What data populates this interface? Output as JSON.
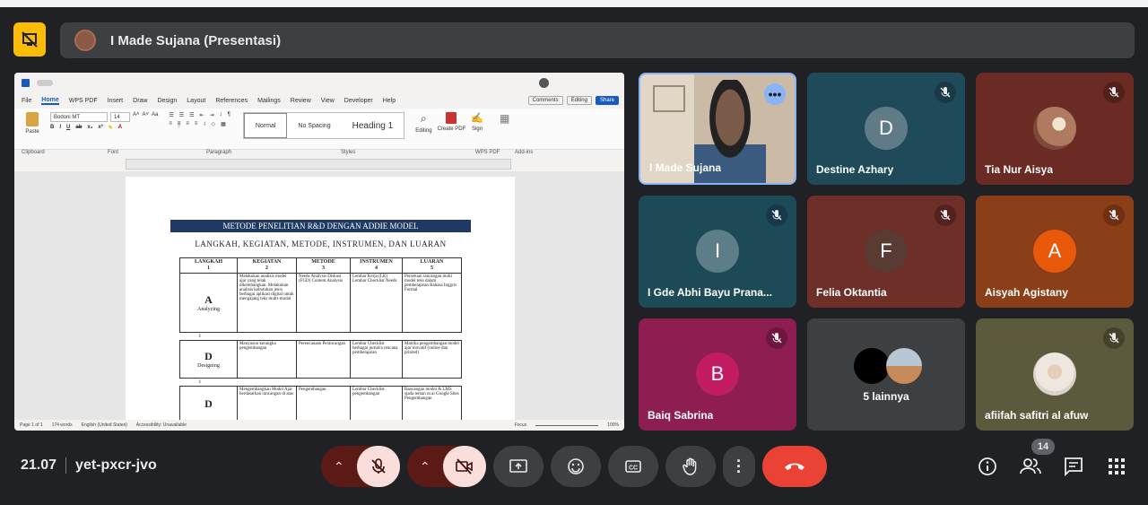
{
  "presenter": {
    "name": "I Made Sujana (Presentasi)"
  },
  "word": {
    "tabs": [
      "File",
      "Home",
      "WPS PDF",
      "Insert",
      "Draw",
      "Design",
      "Layout",
      "References",
      "Mailings",
      "Review",
      "View",
      "Developer",
      "Help"
    ],
    "active_tab": "Home",
    "comments_label": "Comments",
    "editing_label": "Editing",
    "share_label": "Share",
    "font_name": "Bodoni MT",
    "font_size": "14",
    "paste_label": "Paste",
    "styles": [
      "Normal",
      "No Spacing",
      "Heading 1"
    ],
    "ribbon_right": [
      "Editing",
      "Create PDF",
      "Sign"
    ],
    "group_labels": [
      "Clipboard",
      "Font",
      "Paragraph",
      "Styles",
      "WPS PDF",
      "Add-ins"
    ],
    "doc_title": "METODE PENELITIAN R&D DENGAN ADDIE MODEL",
    "doc_subtitle": "LANGKAH, KEGIATAN, METODE, INSTRUMEN, DAN LUARAN",
    "table_headers": [
      {
        "label": "LANGKAH",
        "num": "1"
      },
      {
        "label": "KEGIATAN",
        "num": "2"
      },
      {
        "label": "METODE",
        "num": "3"
      },
      {
        "label": "INSTRUMEN",
        "num": "4"
      },
      {
        "label": "LUARAN",
        "num": "5"
      }
    ],
    "rows": [
      {
        "letter": "A",
        "step": "Analyzing",
        "kegiatan": "Melakukan analisis model ajar yang telah dikembangkan. Melakukan analisis kebutuhan jenis berbagai aplikasi digital untuk mengajang teks multi-modal",
        "metode": "Needs Analysis Diskusi (FGD) Content Analysis",
        "instrumen": "Lembar Kerja (LK) Lembar Checklist Needs",
        "luaran": "Persetuan rancangan multi model teks dalam pembelajaran Bahasa Inggris Formal"
      },
      {
        "letter": "D",
        "step": "Designing",
        "kegiatan": "Menyusun kerangka pengembangan",
        "metode": "Perencanaan Perancangan",
        "instrumen": "Lembar Checklist berbagai jurnal/a rencana pembelajaran",
        "luaran": "Matriks pengembangan model ajar inovatif (online dan printed)"
      },
      {
        "letter": "D",
        "step": "",
        "kegiatan": "Mengembangkan Model Ajar berdasarkan rancangan di atas",
        "metode": "Pengembangan",
        "instrumen": "Lembar Checklist pengembangan",
        "luaran": "Rancangan model & LMS sjada teman nr.ai Google Sites Pengembangan"
      }
    ],
    "status": [
      "Page 1 of 1",
      "174 words",
      "English (United States)",
      "Accessibility: Unavailable",
      "Focus",
      "100%"
    ]
  },
  "participants": [
    {
      "name": "I Made Sujana",
      "type": "video",
      "bg": "#c9b9a6",
      "more": true
    },
    {
      "name": "Destine Azhary",
      "initial": "D",
      "bg": "#1f4a5a",
      "circ": "#5f7b86",
      "muted": true
    },
    {
      "name": "Tia Nur Aisya",
      "bg": "#6b2a24",
      "avatar": "photo",
      "muted": true
    },
    {
      "name": "I Gde Abhi Bayu Prana...",
      "initial": "I",
      "bg": "#1d4a57",
      "circ": "#5d7e88",
      "muted": true
    },
    {
      "name": "Felia Oktantia",
      "initial": "F",
      "bg": "#6d2f27",
      "circ": "#5a3b33",
      "muted": true
    },
    {
      "name": "Aisyah Agistany",
      "initial": "A",
      "bg": "#8a3f18",
      "circ": "#e8590c",
      "muted": true
    },
    {
      "name": "Baiq Sabrina",
      "initial": "B",
      "bg": "#8e1d52",
      "circ": "#c41c62",
      "muted": true
    },
    {
      "name": "5 lainnya",
      "bg": "#3c4043",
      "group": true
    },
    {
      "name": "afiifah safitri al afuw",
      "bg": "#5c5a3c",
      "avatar": "photo",
      "muted": true
    }
  ],
  "meeting": {
    "time": "21.07",
    "code": "yet-pxcr-jvo",
    "people_count": "14"
  },
  "colors": {
    "accent_yellow": "#fbbc04",
    "end_call": "#ea4335",
    "muted_ctrl": "#f9dedc",
    "tile_bg": "#3c4043"
  }
}
